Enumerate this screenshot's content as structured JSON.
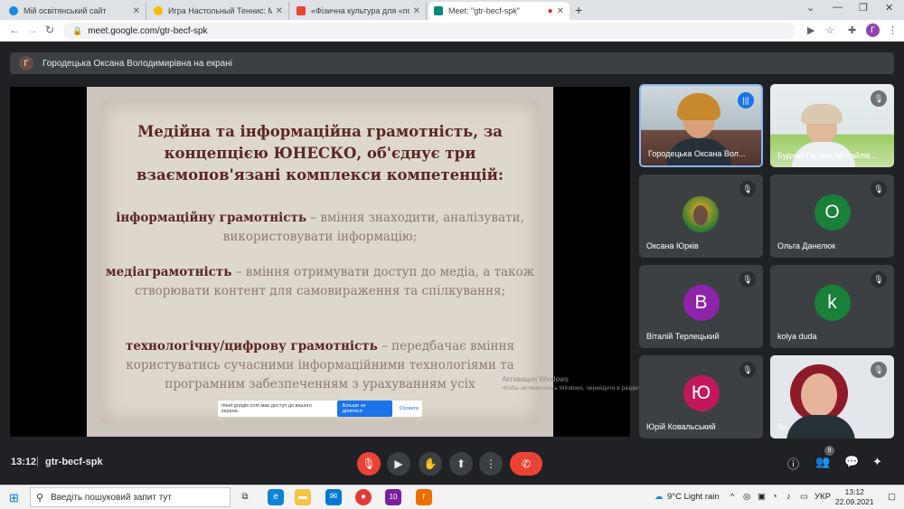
{
  "browser": {
    "tabs": [
      {
        "title": "Мій освітянський сайт",
        "color": "#1e88e5"
      },
      {
        "title": "Игра Настольный Теннис: Мир",
        "color": "#fbbc05"
      },
      {
        "title": "«Фізична культура для «поколі",
        "color": "#ea4335"
      },
      {
        "title": "Meet: \"gtr-becf-spk\"",
        "color": "#00897b"
      }
    ],
    "newtab": "+",
    "url": "meet.google.com/gtr-becf-spk",
    "profile_initial": "Г",
    "window_controls": [
      "⌄",
      "—",
      "❐",
      "✕"
    ]
  },
  "meet": {
    "presenter_banner": "Городецька Оксана Володимирівна на екрані",
    "presenter_initial": "Г",
    "slide": {
      "title_lines": [
        "Медійна та інформаційна грамотність, за",
        "концепцією ЮНЕСКО, об'єднує три",
        "взаємопов'язані комплекси компетенцій:"
      ],
      "p1_bold": "інформаційну грамотність",
      "p1_text": " – вміння знаходити, аналізувати, використовувати інформацію;",
      "p2_bold": "медіаграмотність",
      "p2_text": " – вміння отримувати доступ до медіа, а також створювати контент для самовираження та спілкування;",
      "p3_bold": "технологічну/цифрову грамотність",
      "p3_text": " – передбачає вміння користуватись сучасними інформаційними технологіями та програмним забезпеченням з урахуванням усіх"
    },
    "share_toast": {
      "text": "meet.google.com має доступ до вашого екрана.",
      "stop": "Більше не ділитися",
      "hide": "Сховати"
    },
    "activate_windows": {
      "title": "Активация Windows",
      "sub": "Чтобы активировать Windows, перейдите в раздел \"Параметры\"."
    },
    "participants": [
      {
        "name": "Городецька Оксана Вол...",
        "type": "video",
        "speaking": true
      },
      {
        "name": "Буднак Галина Михайлів...",
        "type": "video",
        "speaking": false
      },
      {
        "name": "Оксана Юрків",
        "type": "photo",
        "speaking": false
      },
      {
        "name": "Ольга Данелюк",
        "type": "letter",
        "initial": "О",
        "color": "#188038",
        "speaking": false
      },
      {
        "name": "Віталій Терлецький",
        "type": "letter",
        "initial": "В",
        "color": "#8e24aa",
        "speaking": false
      },
      {
        "name": "kolya duda",
        "type": "letter",
        "initial": "k",
        "color": "#188038",
        "speaking": false
      },
      {
        "name": "Юрій Ковальський",
        "type": "letter",
        "initial": "Ю",
        "color": "#c2185b",
        "speaking": false
      },
      {
        "name": "Ви",
        "type": "video",
        "speaking": false
      }
    ],
    "bottom": {
      "time": "13:12",
      "separator": "|",
      "code": "gtr-becf-spk",
      "participants_count": "9"
    }
  },
  "taskbar": {
    "search_placeholder": "Введіть пошуковий запит тут",
    "weather": "9°C  Light rain",
    "lang": "УКР",
    "time": "13:12",
    "date": "22.09.2021",
    "notif_badge": "10"
  }
}
